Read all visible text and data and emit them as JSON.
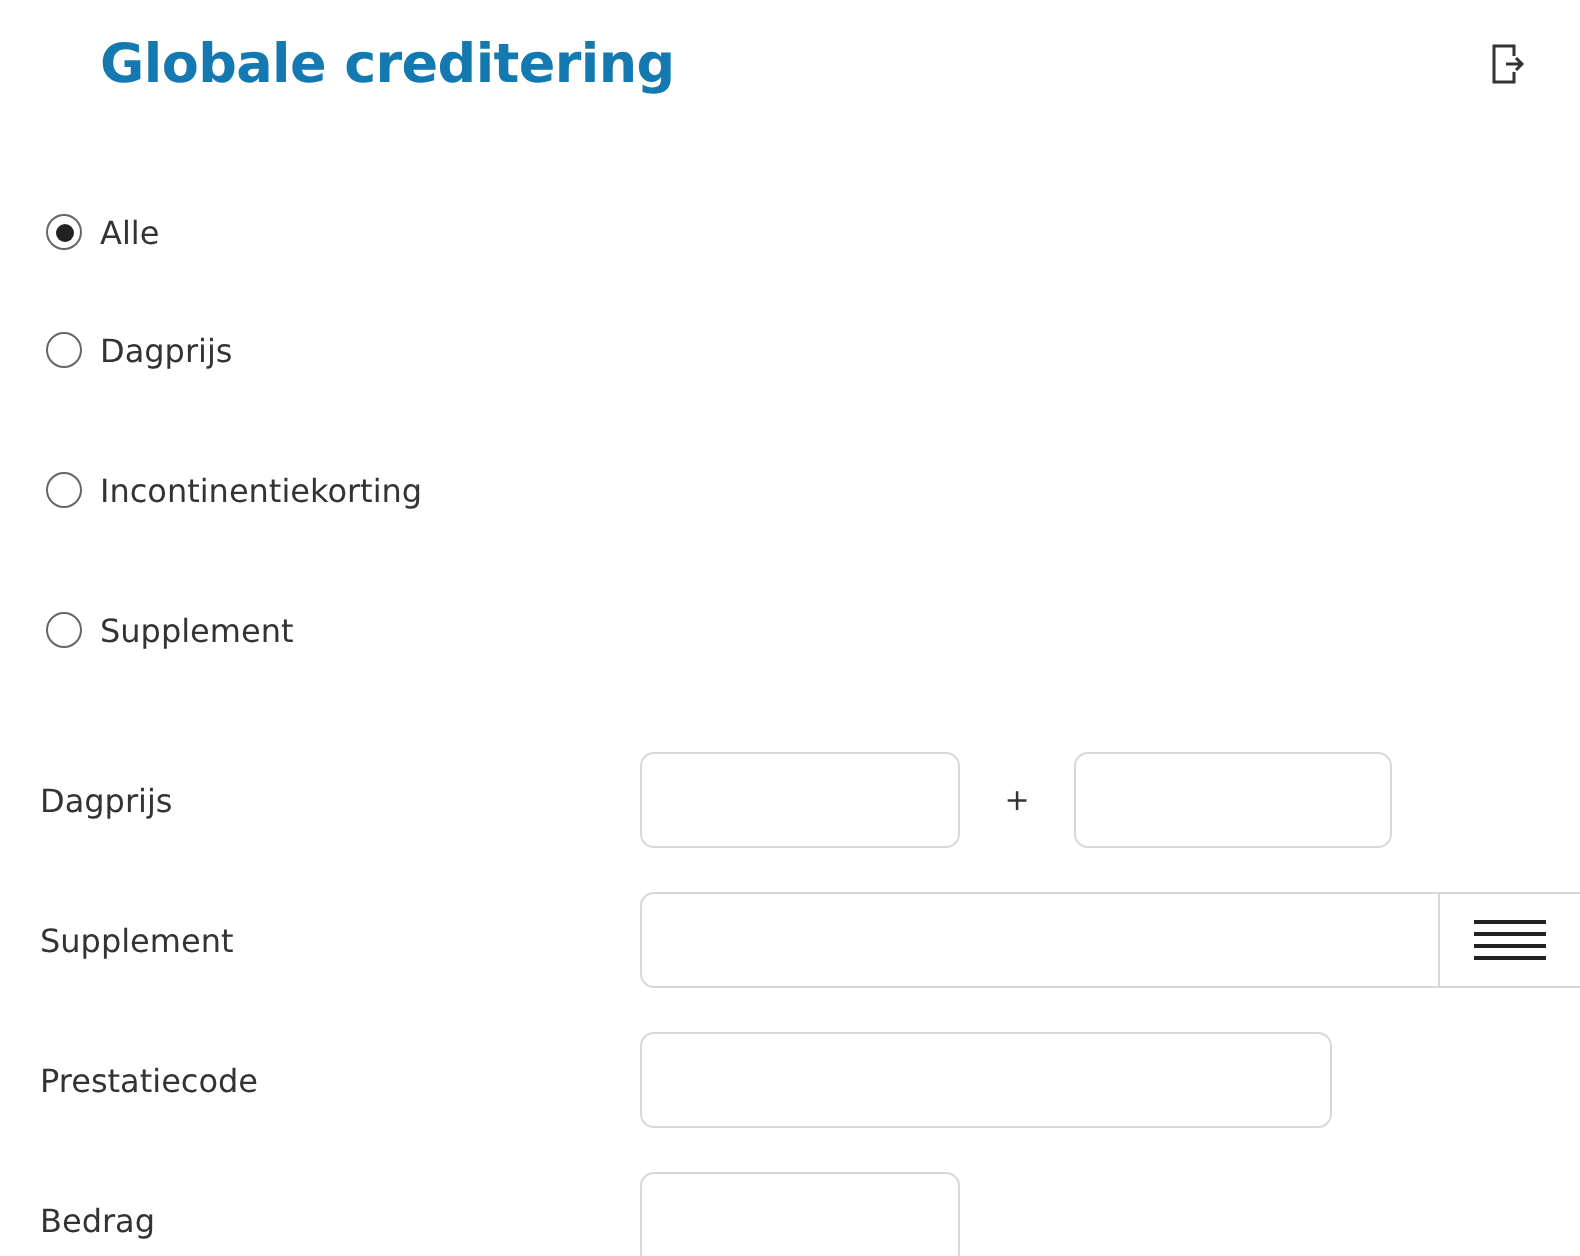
{
  "title": "Globale creditering",
  "options": [
    {
      "label": "Alle",
      "selected": true
    },
    {
      "label": "Dagprijs",
      "selected": false
    },
    {
      "label": "Incontinentiekorting",
      "selected": false
    },
    {
      "label": "Supplement",
      "selected": false
    }
  ],
  "fields": [
    {
      "label": "Dagprijs",
      "kind": "range",
      "separator": "+"
    },
    {
      "label": "Supplement",
      "kind": "lookup"
    },
    {
      "label": "Prestatiecode",
      "kind": "long"
    },
    {
      "label": "Bedrag",
      "kind": "short"
    }
  ]
}
